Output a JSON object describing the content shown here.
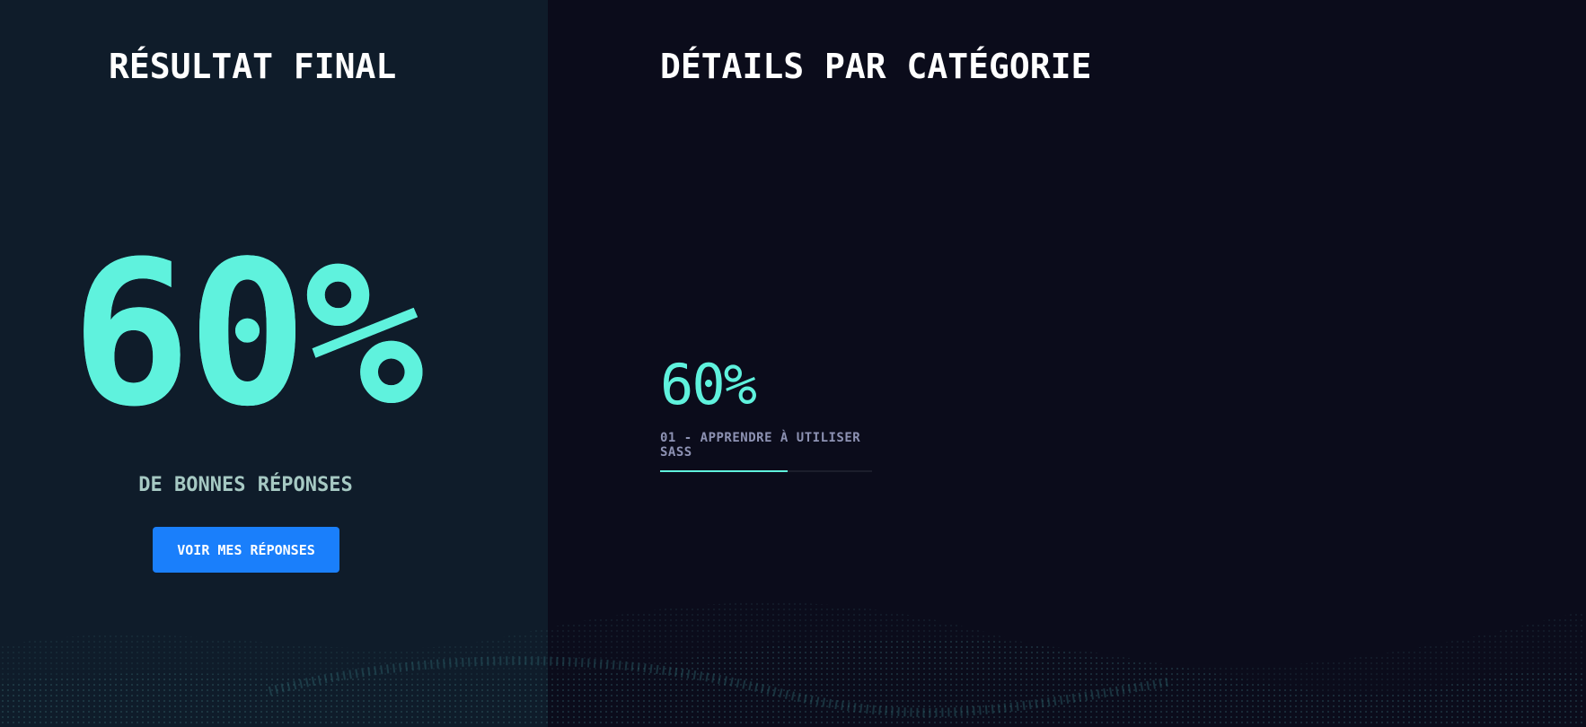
{
  "final_result": {
    "title": "RÉSULTAT FINAL",
    "score": "60%",
    "caption": "DE BONNES RÉPONSES",
    "button_label": "VOIR MES RÉPONSES"
  },
  "details": {
    "title": "DÉTAILS PAR CATÉGORIE",
    "categories": [
      {
        "score": "60%",
        "label": "01 - APPRENDRE À UTILISER SASS",
        "progress": 0.6
      }
    ]
  },
  "colors": {
    "accent": "#5ff2dd",
    "button": "#1a7ffb",
    "left_panel": "#0f1c2a",
    "right_panel": "#0b0c1b",
    "caption": "#a6c9c3",
    "category_label": "#8d92b3"
  }
}
